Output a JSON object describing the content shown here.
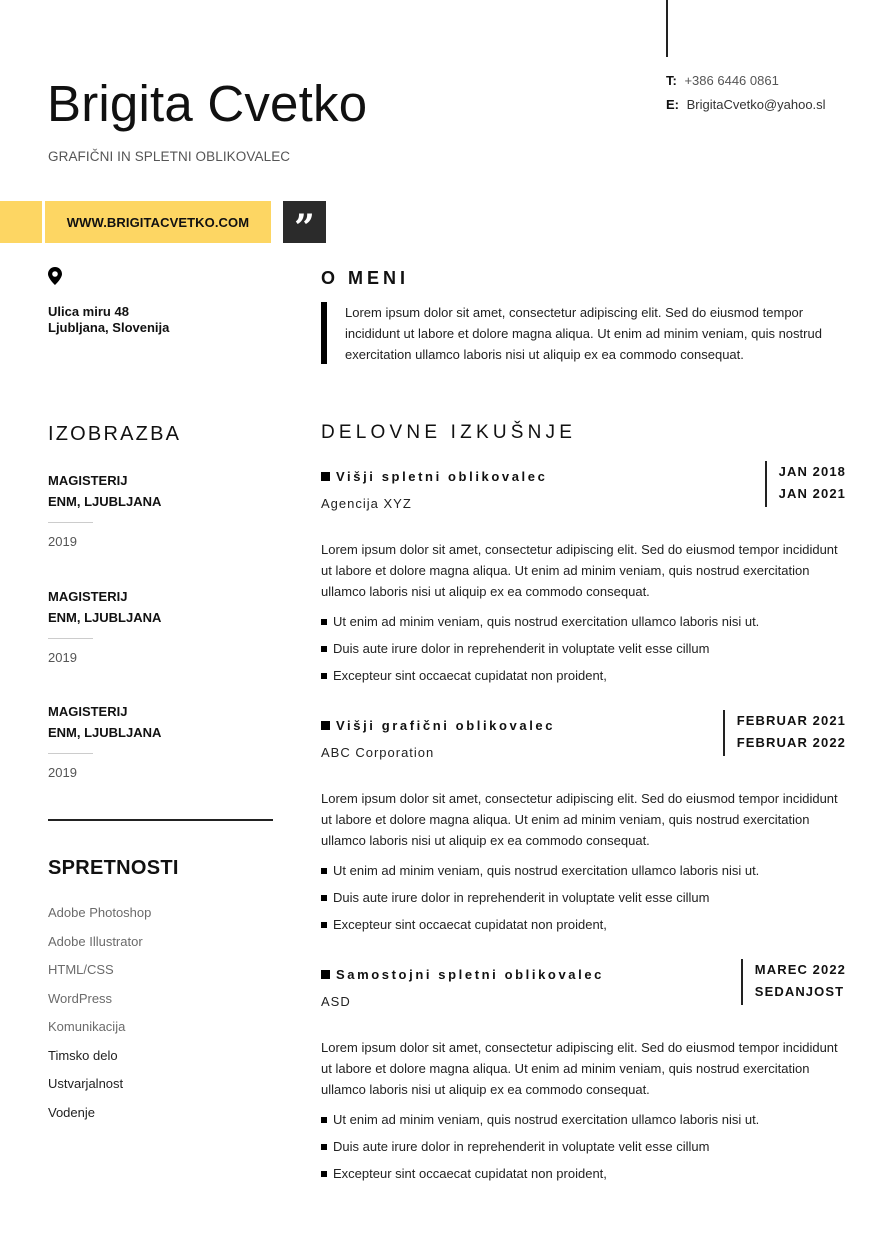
{
  "header": {
    "name": "Brigita Cvetko",
    "subtitle": "GRAFIČNI IN SPLETNI OBLIKOVALEC",
    "website": "WWW.BRIGITACVETKO.COM",
    "quote_glyph": "”"
  },
  "contact": {
    "phone_label": "T:",
    "phone": "+386 6446 0861",
    "email_label": "E:",
    "email": "BrigitaCvetko@yahoo.sl"
  },
  "address": {
    "icon": "map-pin-icon",
    "line1": "Ulica miru 48",
    "line2": "Ljubljana, Slovenija"
  },
  "about": {
    "title": "O MENI",
    "text": "Lorem ipsum dolor sit amet, consectetur adipiscing elit. Sed do eiusmod tempor incididunt ut labore et dolore magna aliqua. Ut enim ad minim veniam, quis nostrud exercitation ullamco laboris nisi ut aliquip ex ea commodo consequat."
  },
  "education": {
    "title": "IZOBRAZBA",
    "items": [
      {
        "degree": "MAGISTERIJ",
        "school": "ENM, LJUBLJANA",
        "year": "2019"
      },
      {
        "degree": "MAGISTERIJ",
        "school": "ENM, LJUBLJANA",
        "year": "2019"
      },
      {
        "degree": "MAGISTERIJ",
        "school": "ENM, LJUBLJANA",
        "year": "2019"
      }
    ]
  },
  "skills": {
    "title": "SPRETNOSTI",
    "items": [
      {
        "label": "Adobe Photoshop",
        "tone": "muted"
      },
      {
        "label": "Adobe Illustrator",
        "tone": "muted"
      },
      {
        "label": "HTML/CSS",
        "tone": "muted"
      },
      {
        "label": "WordPress",
        "tone": "muted"
      },
      {
        "label": "Komunikacija",
        "tone": "muted"
      },
      {
        "label": "Timsko delo",
        "tone": "dark"
      },
      {
        "label": "Ustvarjalnost",
        "tone": "dark"
      },
      {
        "label": "Vodenje",
        "tone": "dark"
      }
    ]
  },
  "experience": {
    "title": "DELOVNE IZKUŠNJE",
    "jobs": [
      {
        "title": "Višji spletni oblikovalec",
        "company": "Agencija XYZ",
        "start": "JAN 2018",
        "end": "JAN 2021",
        "description": "Lorem ipsum dolor sit amet, consectetur adipiscing elit. Sed do eiusmod tempor incididunt ut labore et dolore magna aliqua. Ut enim ad minim veniam, quis nostrud exercitation ullamco laboris nisi ut aliquip ex ea commodo consequat.",
        "bullets": [
          "Ut enim ad minim veniam, quis nostrud exercitation ullamco laboris nisi ut.",
          "Duis aute irure dolor in reprehenderit in voluptate velit esse cillum",
          "Excepteur sint occaecat cupidatat non proident,"
        ]
      },
      {
        "title": "Višji grafični oblikovalec",
        "company": "ABC Corporation",
        "start": "FEBRUAR 2021",
        "end": "FEBRUAR 2022",
        "description": "Lorem ipsum dolor sit amet, consectetur adipiscing elit. Sed do eiusmod tempor incididunt ut labore et dolore magna aliqua. Ut enim ad minim veniam, quis nostrud exercitation ullamco laboris nisi ut aliquip ex ea commodo consequat.",
        "bullets": [
          "Ut enim ad minim veniam, quis nostrud exercitation ullamco laboris nisi ut.",
          "Duis aute irure dolor in reprehenderit in voluptate velit esse cillum",
          "Excepteur sint occaecat cupidatat non proident,"
        ]
      },
      {
        "title": "Samostojni spletni oblikovalec",
        "company": "ASD",
        "start": "MAREC 2022",
        "end": "SEDANJOST",
        "description": "Lorem ipsum dolor sit amet, consectetur adipiscing elit. Sed do eiusmod tempor incididunt ut labore et dolore magna aliqua. Ut enim ad minim veniam, quis nostrud exercitation ullamco laboris nisi ut aliquip ex ea commodo consequat.",
        "bullets": [
          "Ut enim ad minim veniam, quis nostrud exercitation ullamco laboris nisi ut.",
          "Duis aute irure dolor in reprehenderit in voluptate velit esse cillum",
          "Excepteur sint occaecat cupidatat non proident,"
        ]
      }
    ]
  },
  "colors": {
    "accent_yellow": "#FDD663",
    "dark_box": "#2B2B2B",
    "text": "#111111",
    "muted_text": "#6B6B6B"
  }
}
